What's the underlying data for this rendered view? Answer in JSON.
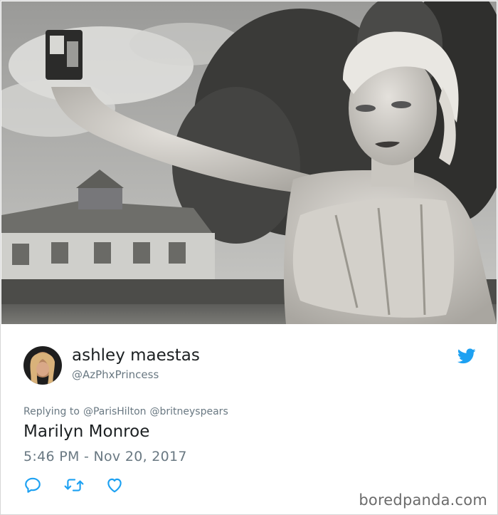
{
  "tweet": {
    "display_name": "ashley maestas",
    "handle": "@AzPhxPrincess",
    "replying_prefix": "Replying to",
    "replying_to": [
      "@ParisHilton",
      "@britneyspears"
    ],
    "text": "Marilyn Monroe",
    "timestamp": "5:46 PM - Nov 20, 2017"
  },
  "icons": {
    "brand": "twitter-bird-icon",
    "reply": "reply-icon",
    "retweet": "retweet-icon",
    "like": "heart-icon"
  },
  "colors": {
    "twitter_blue": "#1da1f2",
    "text_primary": "#1c2022",
    "text_secondary": "#697882"
  },
  "watermark": "boredpanda.com"
}
